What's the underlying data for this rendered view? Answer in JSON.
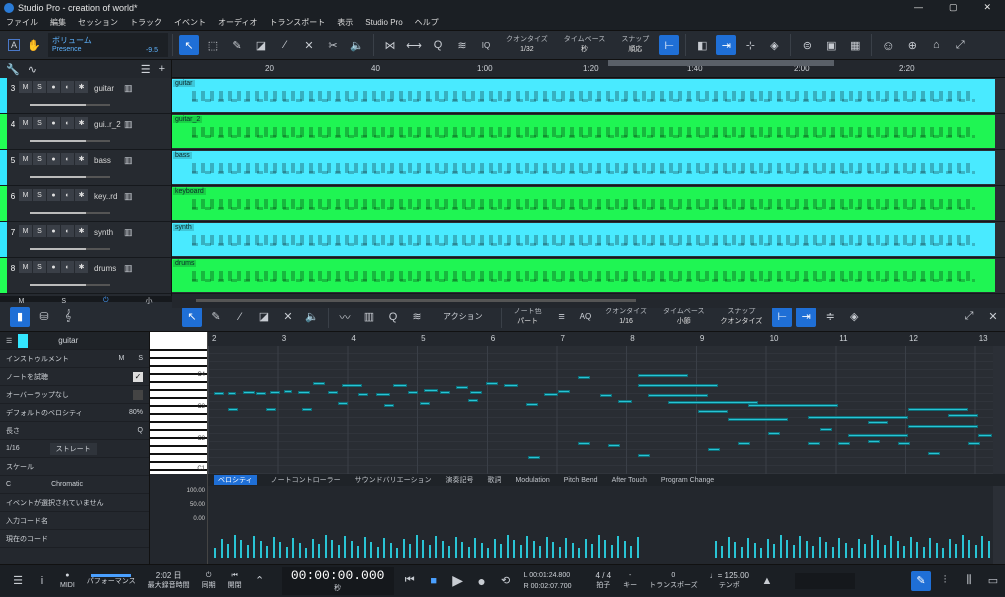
{
  "window": {
    "title": "Studio Pro - creation of world*",
    "controls": [
      "—",
      "▢",
      "✕"
    ]
  },
  "menu": [
    "ファイル",
    "編集",
    "セッション",
    "トラック",
    "イベント",
    "オーディオ",
    "トランスポート",
    "表示",
    "Studio Pro",
    "ヘルプ"
  ],
  "toolbar": {
    "param_name": "ボリューム",
    "param_target": "Presence",
    "param_value": "-9.5",
    "quantize": {
      "label": "クオンタイズ",
      "value": "1/32"
    },
    "timebase": {
      "label": "タイムベース",
      "value": "秒"
    },
    "snap": {
      "label": "スナップ",
      "value": "順応"
    },
    "iq": "IQ"
  },
  "tracks": [
    {
      "num": "3",
      "name": "guitar",
      "color": "#33e6ff",
      "clip_color": "#49eaff"
    },
    {
      "num": "4",
      "name": "gui..r_2",
      "color": "#22ff55",
      "clip_color": "#1ff553"
    },
    {
      "num": "5",
      "name": "bass",
      "color": "#33e6ff",
      "clip_color": "#49eaff"
    },
    {
      "num": "6",
      "name": "key..rd",
      "color": "#22ff55",
      "clip_color": "#1ff553"
    },
    {
      "num": "7",
      "name": "synth",
      "color": "#33e6ff",
      "clip_color": "#49eaff"
    },
    {
      "num": "8",
      "name": "drums",
      "color": "#22ff55",
      "clip_color": "#1ff553"
    }
  ],
  "clip_labels": [
    "guitar",
    "guitar_2",
    "bass",
    "keyboard",
    "synth",
    "drums"
  ],
  "track_buttons": [
    "M",
    "S",
    "●",
    "◐"
  ],
  "arrange_ruler": [
    "20",
    "40",
    "1:00",
    "1:20",
    "1:40",
    "2:00",
    "2:20"
  ],
  "tracklist_footer": [
    "M",
    "S",
    "⏻",
    "小"
  ],
  "editor_toolbar": {
    "action": "アクション",
    "note_color": {
      "label": "ノート色",
      "value": "パート"
    },
    "quantize": {
      "label": "クオンタイズ",
      "value": "1/16"
    },
    "timebase": {
      "label": "タイムベース",
      "value": "小節"
    },
    "snap": {
      "label": "スナップ",
      "value": "クオンタイズ"
    },
    "aq": "AQ"
  },
  "inspector": {
    "track": "guitar",
    "instrument": "インストゥルメント",
    "m": "M",
    "s": "S",
    "audition": "ノートを試聴",
    "overlap": "オーバーラップなし",
    "default_velocity": "デフォルトのベロシティ",
    "velocity_value": "80%",
    "length": "長さ",
    "q": "Q",
    "length_value": "1/16",
    "length_mode": "ストレート",
    "scale": "スケール",
    "scale_root": "C",
    "scale_type": "Chromatic",
    "no_event": "イベントが選択されていません",
    "input_chord": "入力コード名",
    "current_chord": "現在のコード"
  },
  "roll_ruler": [
    "2",
    "3",
    "4",
    "5",
    "6",
    "7",
    "8",
    "9",
    "10",
    "11",
    "12",
    "13"
  ],
  "key_labels": [
    "C4",
    "C3",
    "C2",
    "C1"
  ],
  "controller_tabs": [
    "ベロシティ",
    "ノートコントローラー",
    "サウンドバリエーション",
    "演奏記号",
    "歌詞",
    "Modulation",
    "Pitch Bend",
    "After Touch",
    "Program Change"
  ],
  "velocity_scale": [
    "100.00",
    "50.00",
    "0.00"
  ],
  "transport": {
    "midi": "MIDI",
    "performance": "パフォーマンス",
    "record_days": "2:02 日",
    "record_label": "最大録音時間",
    "sync": "同期",
    "time": "00:00:00.000",
    "time_unit": "秒",
    "L": "00:01:24.800",
    "R": "00:02:07.700",
    "signature": "4 / 4",
    "sig_label": "拍子",
    "key": "-",
    "key_label": "キー",
    "transpose": "0",
    "transpose_label": "トランスポーズ",
    "tempo": "♩= 125.00",
    "tempo_label": "テンポ",
    "timing_label": "開閉"
  }
}
